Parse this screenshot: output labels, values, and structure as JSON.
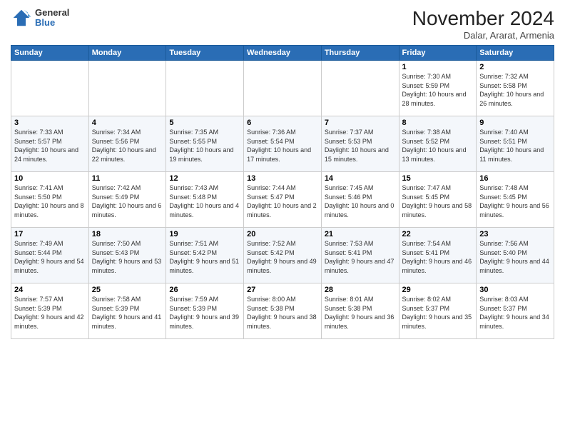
{
  "header": {
    "logo_general": "General",
    "logo_blue": "Blue",
    "month_title": "November 2024",
    "subtitle": "Dalar, Ararat, Armenia"
  },
  "days_of_week": [
    "Sunday",
    "Monday",
    "Tuesday",
    "Wednesday",
    "Thursday",
    "Friday",
    "Saturday"
  ],
  "weeks": [
    [
      {
        "day": "",
        "info": ""
      },
      {
        "day": "",
        "info": ""
      },
      {
        "day": "",
        "info": ""
      },
      {
        "day": "",
        "info": ""
      },
      {
        "day": "",
        "info": ""
      },
      {
        "day": "1",
        "info": "Sunrise: 7:30 AM\nSunset: 5:59 PM\nDaylight: 10 hours and 28 minutes."
      },
      {
        "day": "2",
        "info": "Sunrise: 7:32 AM\nSunset: 5:58 PM\nDaylight: 10 hours and 26 minutes."
      }
    ],
    [
      {
        "day": "3",
        "info": "Sunrise: 7:33 AM\nSunset: 5:57 PM\nDaylight: 10 hours and 24 minutes."
      },
      {
        "day": "4",
        "info": "Sunrise: 7:34 AM\nSunset: 5:56 PM\nDaylight: 10 hours and 22 minutes."
      },
      {
        "day": "5",
        "info": "Sunrise: 7:35 AM\nSunset: 5:55 PM\nDaylight: 10 hours and 19 minutes."
      },
      {
        "day": "6",
        "info": "Sunrise: 7:36 AM\nSunset: 5:54 PM\nDaylight: 10 hours and 17 minutes."
      },
      {
        "day": "7",
        "info": "Sunrise: 7:37 AM\nSunset: 5:53 PM\nDaylight: 10 hours and 15 minutes."
      },
      {
        "day": "8",
        "info": "Sunrise: 7:38 AM\nSunset: 5:52 PM\nDaylight: 10 hours and 13 minutes."
      },
      {
        "day": "9",
        "info": "Sunrise: 7:40 AM\nSunset: 5:51 PM\nDaylight: 10 hours and 11 minutes."
      }
    ],
    [
      {
        "day": "10",
        "info": "Sunrise: 7:41 AM\nSunset: 5:50 PM\nDaylight: 10 hours and 8 minutes."
      },
      {
        "day": "11",
        "info": "Sunrise: 7:42 AM\nSunset: 5:49 PM\nDaylight: 10 hours and 6 minutes."
      },
      {
        "day": "12",
        "info": "Sunrise: 7:43 AM\nSunset: 5:48 PM\nDaylight: 10 hours and 4 minutes."
      },
      {
        "day": "13",
        "info": "Sunrise: 7:44 AM\nSunset: 5:47 PM\nDaylight: 10 hours and 2 minutes."
      },
      {
        "day": "14",
        "info": "Sunrise: 7:45 AM\nSunset: 5:46 PM\nDaylight: 10 hours and 0 minutes."
      },
      {
        "day": "15",
        "info": "Sunrise: 7:47 AM\nSunset: 5:45 PM\nDaylight: 9 hours and 58 minutes."
      },
      {
        "day": "16",
        "info": "Sunrise: 7:48 AM\nSunset: 5:45 PM\nDaylight: 9 hours and 56 minutes."
      }
    ],
    [
      {
        "day": "17",
        "info": "Sunrise: 7:49 AM\nSunset: 5:44 PM\nDaylight: 9 hours and 54 minutes."
      },
      {
        "day": "18",
        "info": "Sunrise: 7:50 AM\nSunset: 5:43 PM\nDaylight: 9 hours and 53 minutes."
      },
      {
        "day": "19",
        "info": "Sunrise: 7:51 AM\nSunset: 5:42 PM\nDaylight: 9 hours and 51 minutes."
      },
      {
        "day": "20",
        "info": "Sunrise: 7:52 AM\nSunset: 5:42 PM\nDaylight: 9 hours and 49 minutes."
      },
      {
        "day": "21",
        "info": "Sunrise: 7:53 AM\nSunset: 5:41 PM\nDaylight: 9 hours and 47 minutes."
      },
      {
        "day": "22",
        "info": "Sunrise: 7:54 AM\nSunset: 5:41 PM\nDaylight: 9 hours and 46 minutes."
      },
      {
        "day": "23",
        "info": "Sunrise: 7:56 AM\nSunset: 5:40 PM\nDaylight: 9 hours and 44 minutes."
      }
    ],
    [
      {
        "day": "24",
        "info": "Sunrise: 7:57 AM\nSunset: 5:39 PM\nDaylight: 9 hours and 42 minutes."
      },
      {
        "day": "25",
        "info": "Sunrise: 7:58 AM\nSunset: 5:39 PM\nDaylight: 9 hours and 41 minutes."
      },
      {
        "day": "26",
        "info": "Sunrise: 7:59 AM\nSunset: 5:39 PM\nDaylight: 9 hours and 39 minutes."
      },
      {
        "day": "27",
        "info": "Sunrise: 8:00 AM\nSunset: 5:38 PM\nDaylight: 9 hours and 38 minutes."
      },
      {
        "day": "28",
        "info": "Sunrise: 8:01 AM\nSunset: 5:38 PM\nDaylight: 9 hours and 36 minutes."
      },
      {
        "day": "29",
        "info": "Sunrise: 8:02 AM\nSunset: 5:37 PM\nDaylight: 9 hours and 35 minutes."
      },
      {
        "day": "30",
        "info": "Sunrise: 8:03 AM\nSunset: 5:37 PM\nDaylight: 9 hours and 34 minutes."
      }
    ]
  ]
}
